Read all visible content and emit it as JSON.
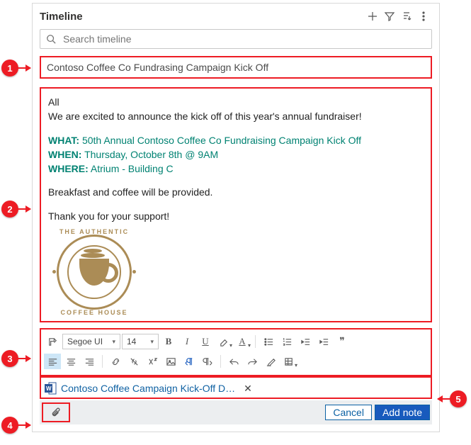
{
  "header": {
    "title": "Timeline",
    "actions": {
      "add": "add-icon",
      "filter": "filter-icon",
      "sort": "sort-icon",
      "more": "more-icon"
    }
  },
  "search": {
    "placeholder": "Search timeline"
  },
  "note": {
    "title": "Contoso Coffee Co Fundrasing Campaign Kick Off",
    "greeting": "All",
    "intro": "We are excited to announce the kick off of this year's annual fundraiser!",
    "what_label": "WHAT:",
    "what_value": "50th Annual Contoso Coffee Co Fundraising Campaign Kick Off",
    "when_label": "WHEN:",
    "when_value": "Thursday, October 8th @ 9AM",
    "where_label": "WHERE:",
    "where_value": "Atrium - Building C",
    "line_food": "Breakfast and coffee will be provided.",
    "line_thanks": "Thank you for your support!",
    "logo_top": "THE AUTHENTIC",
    "logo_bottom": "COFFEE HOUSE"
  },
  "toolbar": {
    "font": "Segoe UI",
    "size": "14"
  },
  "attachment": {
    "name": "Contoso Coffee Campaign Kick-Off D…"
  },
  "footer": {
    "cancel": "Cancel",
    "add": "Add note"
  },
  "callouts": {
    "c1": "1",
    "c2": "2",
    "c3": "3",
    "c4": "4",
    "c5": "5"
  }
}
